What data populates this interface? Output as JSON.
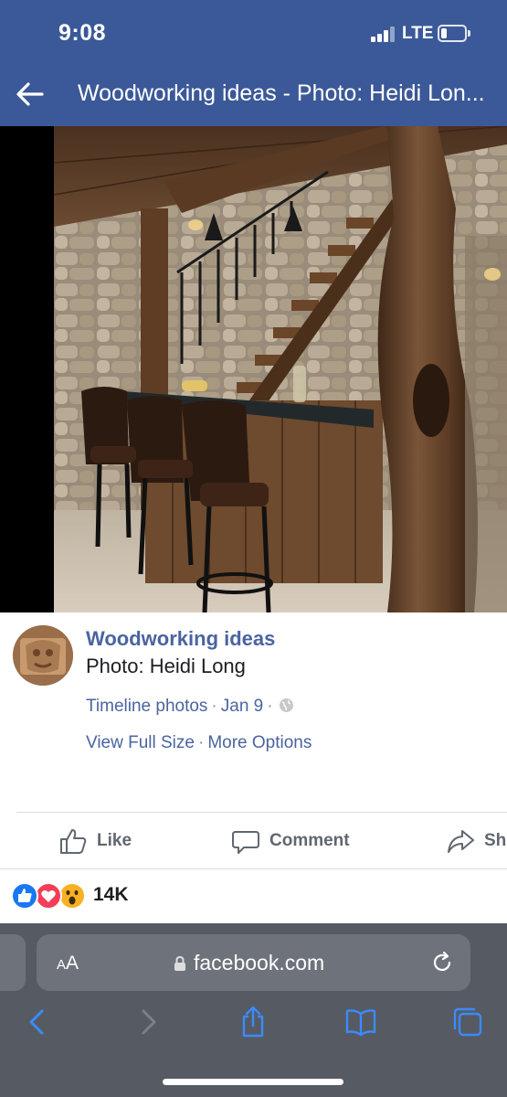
{
  "status_bar": {
    "time": "9:08",
    "network": "LTE"
  },
  "nav": {
    "title": "Woodworking ideas - Photo: Heidi Lon..."
  },
  "post": {
    "page_name": "Woodworking ideas",
    "caption": "Photo: Heidi Long",
    "album": "Timeline photos",
    "date": "Jan 9",
    "view_full_size": "View Full Size",
    "more_options": "More Options"
  },
  "actions": {
    "like": "Like",
    "comment": "Comment",
    "share": "Sh"
  },
  "reactions": {
    "count": "14K",
    "types": [
      "like-icon",
      "love-icon",
      "wow-icon"
    ]
  },
  "browser": {
    "text_size_label": "AA",
    "url": "facebook.com"
  },
  "colors": {
    "header": "#3b5998",
    "link": "#4a64a0",
    "browser_chrome": "#565b63",
    "accent": "#3a8bff"
  }
}
